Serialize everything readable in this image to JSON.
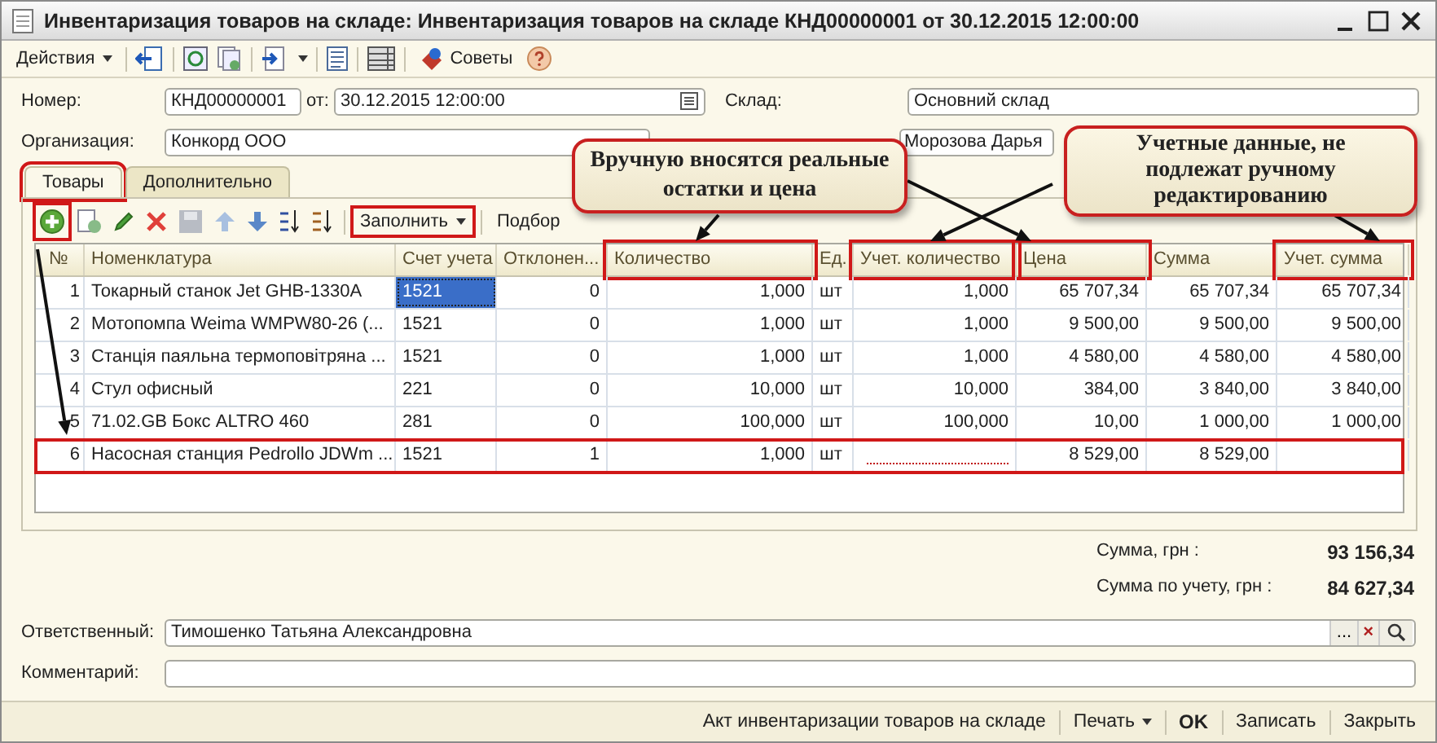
{
  "window": {
    "title": "Инвентаризация товаров на складе: Инвентаризация товаров на складе КНД00000001 от 30.12.2015 12:00:00"
  },
  "toolbar": {
    "actions": "Действия",
    "tips": "Советы"
  },
  "header": {
    "number_label": "Номер:",
    "number": "КНД00000001",
    "date_label": "от:",
    "date": "30.12.2015 12:00:00",
    "warehouse_label": "Склад:",
    "warehouse": "Основний склад",
    "org_label": "Организация:",
    "org": "Конкорд ООО",
    "person": "Морозова Дарья"
  },
  "tabs": [
    {
      "label": "Товары",
      "selected": true,
      "highlighted": true
    },
    {
      "label": "Дополнительно",
      "selected": false,
      "highlighted": false
    }
  ],
  "table_toolbar": {
    "add_highlighted": true,
    "fill": {
      "label": "Заполнить",
      "highlighted": true
    },
    "pick": "Подбор"
  },
  "table": {
    "columns": [
      {
        "label": "№",
        "highlighted": false
      },
      {
        "label": "Номенклатура",
        "highlighted": false
      },
      {
        "label": "Счет учета",
        "highlighted": false
      },
      {
        "label": "Отклонен...",
        "highlighted": false
      },
      {
        "label": "Количество",
        "highlighted": true
      },
      {
        "label": "Ед.",
        "highlighted": false
      },
      {
        "label": "Учет. количество",
        "highlighted": true
      },
      {
        "label": "Цена",
        "highlighted": true
      },
      {
        "label": "Сумма",
        "highlighted": false
      },
      {
        "label": "Учет. сумма",
        "highlighted": true
      }
    ],
    "rows": [
      {
        "n": "1",
        "name": "Токарный станок Jet GHB-1330A",
        "account": "1521",
        "deviation": "0",
        "qty": "1,000",
        "unit": "шт",
        "acc_qty": "1,000",
        "price": "65 707,34",
        "sum": "65 707,34",
        "acc_sum": "65 707,34",
        "selected": true,
        "highlighted": false
      },
      {
        "n": "2",
        "name": "Мотопомпа Weima WMPW80-26 (...",
        "account": "1521",
        "deviation": "0",
        "qty": "1,000",
        "unit": "шт",
        "acc_qty": "1,000",
        "price": "9 500,00",
        "sum": "9 500,00",
        "acc_sum": "9 500,00",
        "selected": false,
        "highlighted": false
      },
      {
        "n": "3",
        "name": "Станція паяльна термоповітряна ...",
        "account": "1521",
        "deviation": "0",
        "qty": "1,000",
        "unit": "шт",
        "acc_qty": "1,000",
        "price": "4 580,00",
        "sum": "4 580,00",
        "acc_sum": "4 580,00",
        "selected": false,
        "highlighted": false
      },
      {
        "n": "4",
        "name": "Стул офисный",
        "account": "221",
        "deviation": "0",
        "qty": "10,000",
        "unit": "шт",
        "acc_qty": "10,000",
        "price": "384,00",
        "sum": "3 840,00",
        "acc_sum": "3 840,00",
        "selected": false,
        "highlighted": false
      },
      {
        "n": "5",
        "name": "71.02.GB Бокс ALTRO 460",
        "account": "281",
        "deviation": "0",
        "qty": "100,000",
        "unit": "шт",
        "acc_qty": "100,000",
        "price": "10,00",
        "sum": "1 000,00",
        "acc_sum": "1 000,00",
        "selected": false,
        "highlighted": false
      },
      {
        "n": "6",
        "name": "Насосная станция Pedrollo JDWm ...",
        "account": "1521",
        "deviation": "1",
        "qty": "1,000",
        "unit": "шт",
        "price": "8 529,00",
        "sum": "8 529,00",
        "selected": false,
        "highlighted": true
      }
    ]
  },
  "totals": [
    {
      "label": "Сумма, грн :",
      "value": "93 156,34"
    },
    {
      "label": "Сумма по учету, грн :",
      "value": "84 627,34"
    }
  ],
  "responsible": {
    "label": "Ответственный:",
    "value": "Тимошенко Татьяна Александровна",
    "choose": "...",
    "clear": "×"
  },
  "comment": {
    "label": "Комментарий:"
  },
  "footer": {
    "buttons": [
      {
        "label": "Акт инвентаризации товаров на складе",
        "kind": "plain"
      },
      {
        "label": "Печать",
        "kind": "menu"
      },
      {
        "label": "OK",
        "kind": "default"
      },
      {
        "label": "Записать",
        "kind": "plain"
      },
      {
        "label": "Закрыть",
        "kind": "plain"
      }
    ]
  },
  "callouts": [
    {
      "text": "Вручную вносятся реальные остатки и цена"
    },
    {
      "text": "Учетные данные, не подлежат ручному редактированию"
    }
  ]
}
